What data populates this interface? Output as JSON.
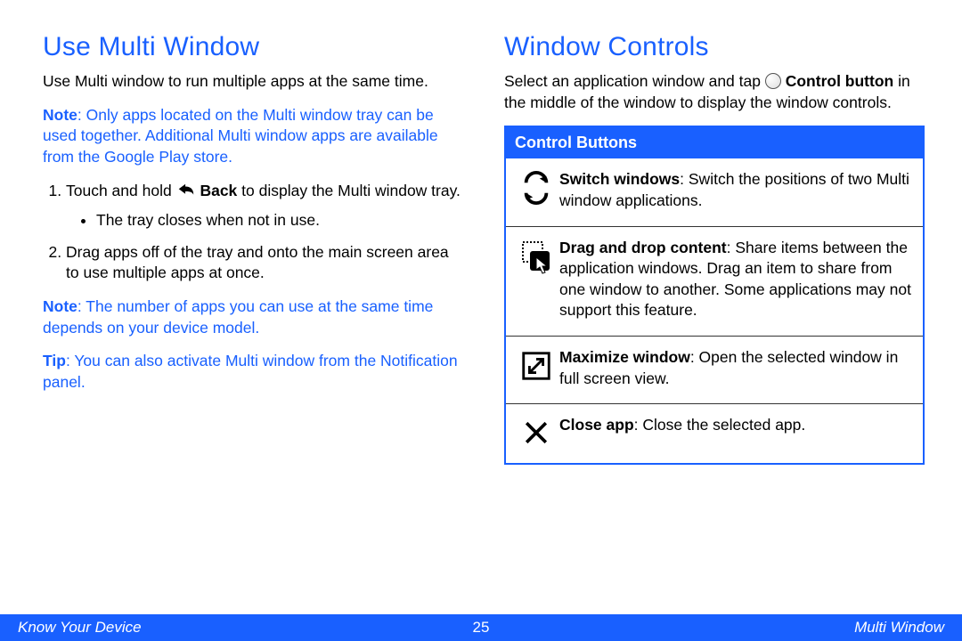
{
  "left": {
    "heading": "Use Multi Window",
    "intro": "Use Multi window to run multiple apps at the same time.",
    "note1_label": "Note",
    "note1_text": ": Only apps located on the Multi window tray can be used together. Additional Multi window apps are available from the Google Play store.",
    "step1_a": "Touch and hold ",
    "step1_back": "Back",
    "step1_b": " to display the Multi window tray.",
    "step1_sub": "The tray closes when not in use.",
    "step2": "Drag apps off of the tray and onto the main screen area to use multiple apps at once.",
    "note2_label": "Note",
    "note2_text": ": The number of apps you can use at the same time depends on your device model.",
    "tip_label": "Tip",
    "tip_text": ": You can also activate Multi window from the Notification panel."
  },
  "right": {
    "heading": "Window Controls",
    "intro_a": "Select an application window and tap ",
    "intro_ctrl": "Control button",
    "intro_b": " in the middle of the window to display the window controls.",
    "panel_title": "Control Buttons",
    "rows": [
      {
        "label": "Switch windows",
        "text": ": Switch the positions of two Multi window applications."
      },
      {
        "label": "Drag and drop content",
        "text": ": Share items between the application windows. Drag an item to share from one window to another. Some applications may not support this feature."
      },
      {
        "label": "Maximize window",
        "text": ": Open the selected window in full screen view."
      },
      {
        "label": "Close app",
        "text": ": Close the selected app."
      }
    ]
  },
  "footer": {
    "left": "Know Your Device",
    "center": "25",
    "right": "Multi Window"
  }
}
